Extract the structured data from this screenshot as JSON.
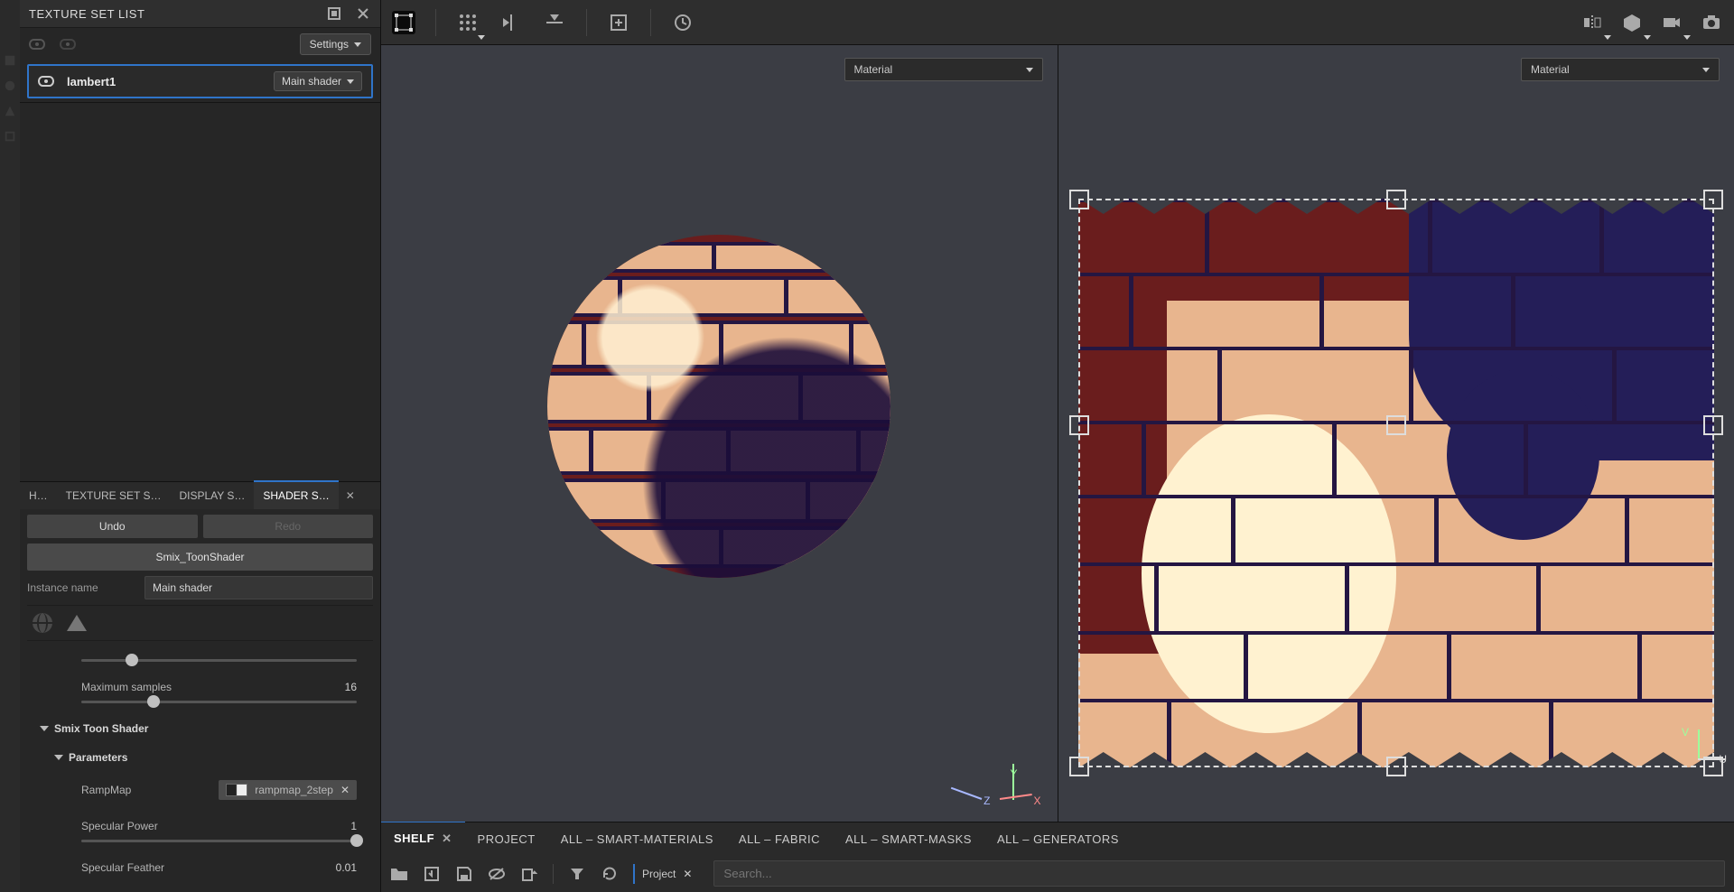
{
  "sidebar": {
    "panel_title": "TEXTURE SET LIST",
    "settings_label": "Settings",
    "item": {
      "name": "lambert1",
      "shader": "Main shader"
    },
    "tabs": [
      "H…",
      "TEXTURE SET S…",
      "DISPLAY S…",
      "SHADER S…"
    ],
    "undo": "Undo",
    "redo": "Redo",
    "shader_preset": "Smix_ToonShader",
    "instance_label": "Instance name",
    "instance_value": "Main shader",
    "params": {
      "max_samples": {
        "label": "Maximum samples",
        "value": "16"
      },
      "section": "Smix Toon Shader",
      "subsection": "Parameters",
      "rampmap": {
        "label": "RampMap",
        "value": "rampmap_2step"
      },
      "spec_power": {
        "label": "Specular Power",
        "value": "1"
      },
      "spec_feather": {
        "label": "Specular Feather",
        "value": "0.01"
      }
    }
  },
  "viewport": {
    "material_label": "Material",
    "axes3d": {
      "x": "X",
      "y": "Y",
      "z": "Z"
    },
    "axes2d": {
      "u": "U",
      "v": "V"
    }
  },
  "footer": {
    "tabs": [
      "SHELF",
      "PROJECT",
      "ALL – SMART-MATERIALS",
      "ALL – FABRIC",
      "ALL – SMART-MASKS",
      "ALL – GENERATORS"
    ],
    "project_chip": "Project",
    "search_placeholder": "Search..."
  },
  "colors": {
    "accent": "#2f74c9",
    "brick_light": "#e8b58e",
    "brick_dark": "#6a1d1d",
    "brick_line": "#241642",
    "highlight": "#fff2d0"
  }
}
